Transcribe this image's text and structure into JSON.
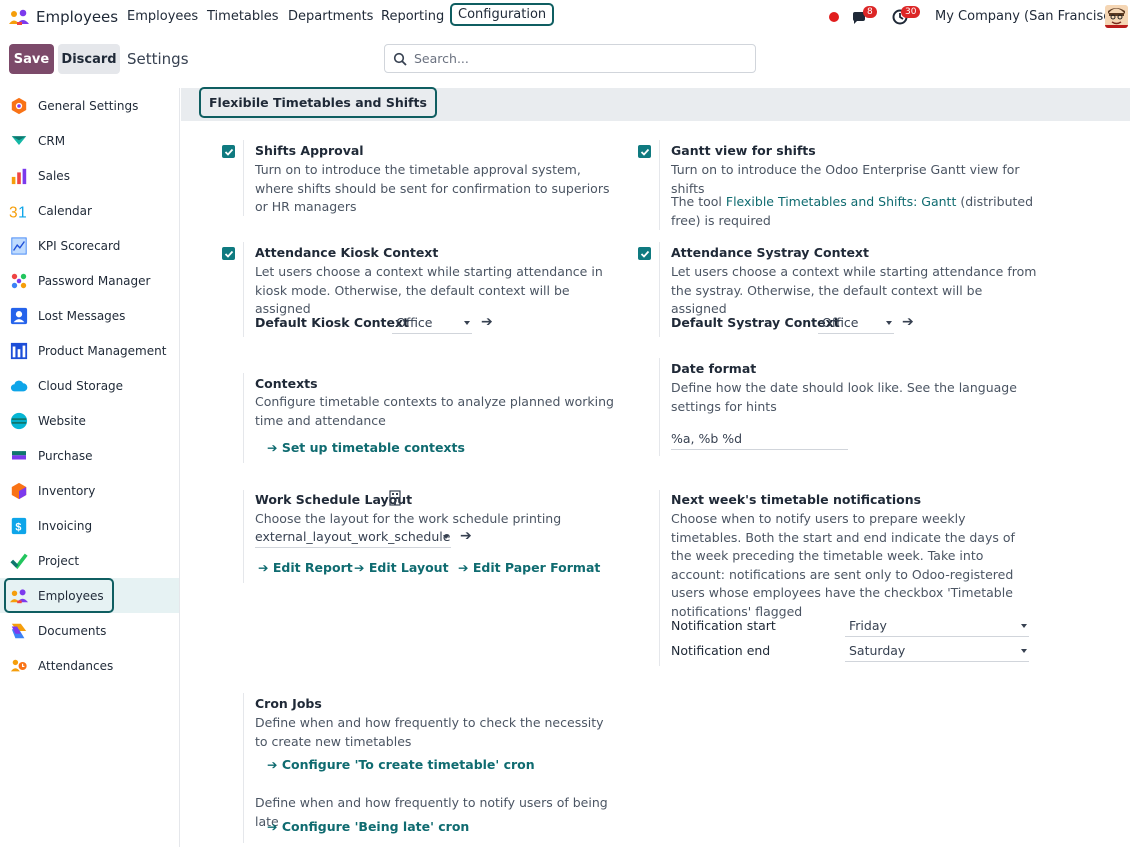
{
  "navbar": {
    "app_title": "Employees",
    "menu": [
      "Employees",
      "Timetables",
      "Departments",
      "Reporting",
      "Configuration"
    ],
    "messages_count": "8",
    "activities_count": "30",
    "company": "My Company (San Francisco)"
  },
  "control_panel": {
    "save_label": "Save",
    "discard_label": "Discard",
    "breadcrumb": "Settings",
    "search_placeholder": "Search..."
  },
  "sidebar": {
    "items": [
      {
        "label": "General Settings",
        "icon": "general-settings-icon",
        "color": "#f97316"
      },
      {
        "label": "CRM",
        "icon": "crm-icon",
        "color": "#14b8a6"
      },
      {
        "label": "Sales",
        "icon": "sales-icon",
        "color": "#f59e0b"
      },
      {
        "label": "Calendar",
        "icon": "calendar-icon",
        "color": "#f59e0b"
      },
      {
        "label": "KPI Scorecard",
        "icon": "kpi-scorecard-icon",
        "color": "#60a5fa"
      },
      {
        "label": "Password Manager",
        "icon": "password-manager-icon",
        "color": "#ef4444"
      },
      {
        "label": "Lost Messages",
        "icon": "lost-messages-icon",
        "color": "#2563eb"
      },
      {
        "label": "Product Management",
        "icon": "product-management-icon",
        "color": "#1d4ed8"
      },
      {
        "label": "Cloud Storage",
        "icon": "cloud-storage-icon",
        "color": "#0ea5e9"
      },
      {
        "label": "Website",
        "icon": "website-icon",
        "color": "#06b6d4"
      },
      {
        "label": "Purchase",
        "icon": "purchase-icon",
        "color": "#0f766e"
      },
      {
        "label": "Inventory",
        "icon": "inventory-icon",
        "color": "#f97316"
      },
      {
        "label": "Invoicing",
        "icon": "invoicing-icon",
        "color": "#0ea5e9"
      },
      {
        "label": "Project",
        "icon": "project-icon",
        "color": "#22c55e"
      },
      {
        "label": "Employees",
        "icon": "employees-icon",
        "color": "#7c3aed"
      },
      {
        "label": "Documents",
        "icon": "documents-icon",
        "color": "#f59e0b"
      },
      {
        "label": "Attendances",
        "icon": "attendances-icon",
        "color": "#f97316"
      }
    ],
    "active": "Employees"
  },
  "section": {
    "title": "Flexibile Timetables and Shifts"
  },
  "settings": {
    "shifts_approval": {
      "title": "Shifts Approval",
      "desc": "Turn on to introduce the timetable approval system, where shifts should be sent for confirmation to superiors or HR managers"
    },
    "gantt_view": {
      "title": "Gantt view for shifts",
      "desc": "Turn on to introduce the Odoo Enterprise Gantt view for shifts",
      "tool_prefix": "The tool ",
      "tool_link": "Flexible Timetables and Shifts: Gantt",
      "tool_suffix": " (distributed free) is required"
    },
    "kiosk_context": {
      "title": "Attendance Kiosk Context",
      "desc": "Let users choose a context while starting attendance in kiosk mode. Otherwise, the default context will be assigned",
      "field_label": "Default Kiosk Context",
      "field_value": "Office"
    },
    "systray_context": {
      "title": "Attendance Systray Context",
      "desc": "Let users choose a context while starting attendance from the systray. Otherwise, the default context will be assigned",
      "field_label": "Default Systray Context",
      "field_value": "Office"
    },
    "contexts": {
      "title": "Contexts",
      "desc": "Configure timetable contexts to analyze planned working time and attendance",
      "link": "Set up timetable contexts"
    },
    "date_format": {
      "title": "Date format",
      "desc": "Define how the date should look like. See the language settings for hints",
      "value": "%a, %b %d"
    },
    "work_schedule": {
      "title": "Work Schedule Layout",
      "desc": "Choose the layout for the work schedule printing",
      "value": "external_layout_work_schedule",
      "links": [
        "Edit Report",
        "Edit Layout",
        "Edit Paper Format"
      ]
    },
    "notifications": {
      "title": "Next week's timetable notifications",
      "desc": "Choose when to notify users to prepare weekly timetables. Both the start and end indicate the days of the week preceding the timetable week. Take into account: notifications are sent only to Odoo-registered users whose employees have the checkbox 'Timetable notifications' flagged",
      "start_label": "Notification start",
      "start_value": "Friday",
      "end_label": "Notification end",
      "end_value": "Saturday"
    },
    "cron_jobs": {
      "title": "Cron Jobs",
      "desc1": "Define when and how frequently to check the necessity to create new timetables",
      "link1": "Configure 'To create timetable' cron",
      "desc2": "Define when and how frequently to notify users of being late",
      "link2": "Configure 'Being late' cron"
    }
  }
}
